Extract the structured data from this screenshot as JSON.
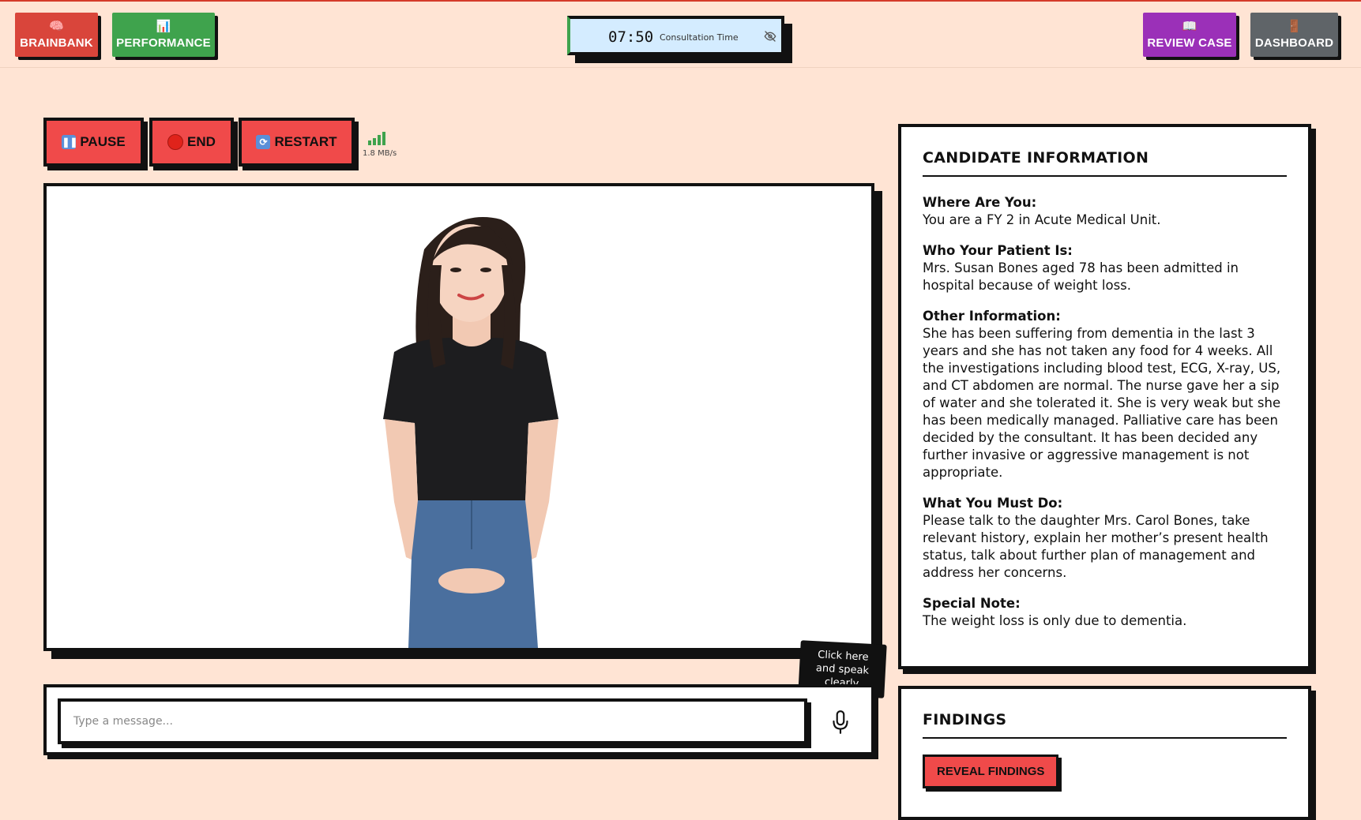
{
  "nav": {
    "brainbank": {
      "label": "BRAINBANK",
      "icon": "🧠",
      "color": "#d9453b"
    },
    "performance": {
      "label": "PERFORMANCE",
      "icon": "📊",
      "color": "#3fa34d"
    },
    "review_case": {
      "label": "REVIEW CASE",
      "icon": "📖",
      "color": "#9b30b8"
    },
    "dashboard": {
      "label": "DASHBOARD",
      "icon": "🚪",
      "color": "#5f6468"
    }
  },
  "timer": {
    "time": "07:50",
    "label": "Consultation Time"
  },
  "controls": {
    "pause": "PAUSE",
    "end": "END",
    "restart": "RESTART",
    "speed": "1.8 MB/s"
  },
  "tooltip": {
    "line1": "Click here",
    "line2": "and speak",
    "line3": "clearly"
  },
  "message": {
    "placeholder": "Type a message..."
  },
  "candidate": {
    "title": "CANDIDATE INFORMATION",
    "sections": [
      {
        "heading": "Where Are You:",
        "text": "You are a FY 2 in Acute Medical Unit."
      },
      {
        "heading": "Who Your Patient Is:",
        "text": "Mrs. Susan Bones aged 78 has been admitted in hospital because of weight loss."
      },
      {
        "heading": "Other Information:",
        "text": "She has been suffering from dementia in the last 3 years and she has not taken any food for 4 weeks. All the investigations including blood test, ECG, X-ray, US, and CT abdomen are normal. The nurse gave her a sip of water and she tolerated it. She is very weak but she has been medically managed. Palliative care has been decided by the consultant. It has been decided any further invasive or aggressive management is not appropriate."
      },
      {
        "heading": "What You Must Do:",
        "text": "Please talk to the daughter Mrs. Carol Bones, take relevant history, explain her mother’s present health status, talk about further plan of management and address her concerns."
      },
      {
        "heading": "Special Note:",
        "text": "The weight loss is only due to dementia."
      }
    ]
  },
  "findings": {
    "title": "FINDINGS",
    "button": "REVEAL FINDINGS"
  }
}
